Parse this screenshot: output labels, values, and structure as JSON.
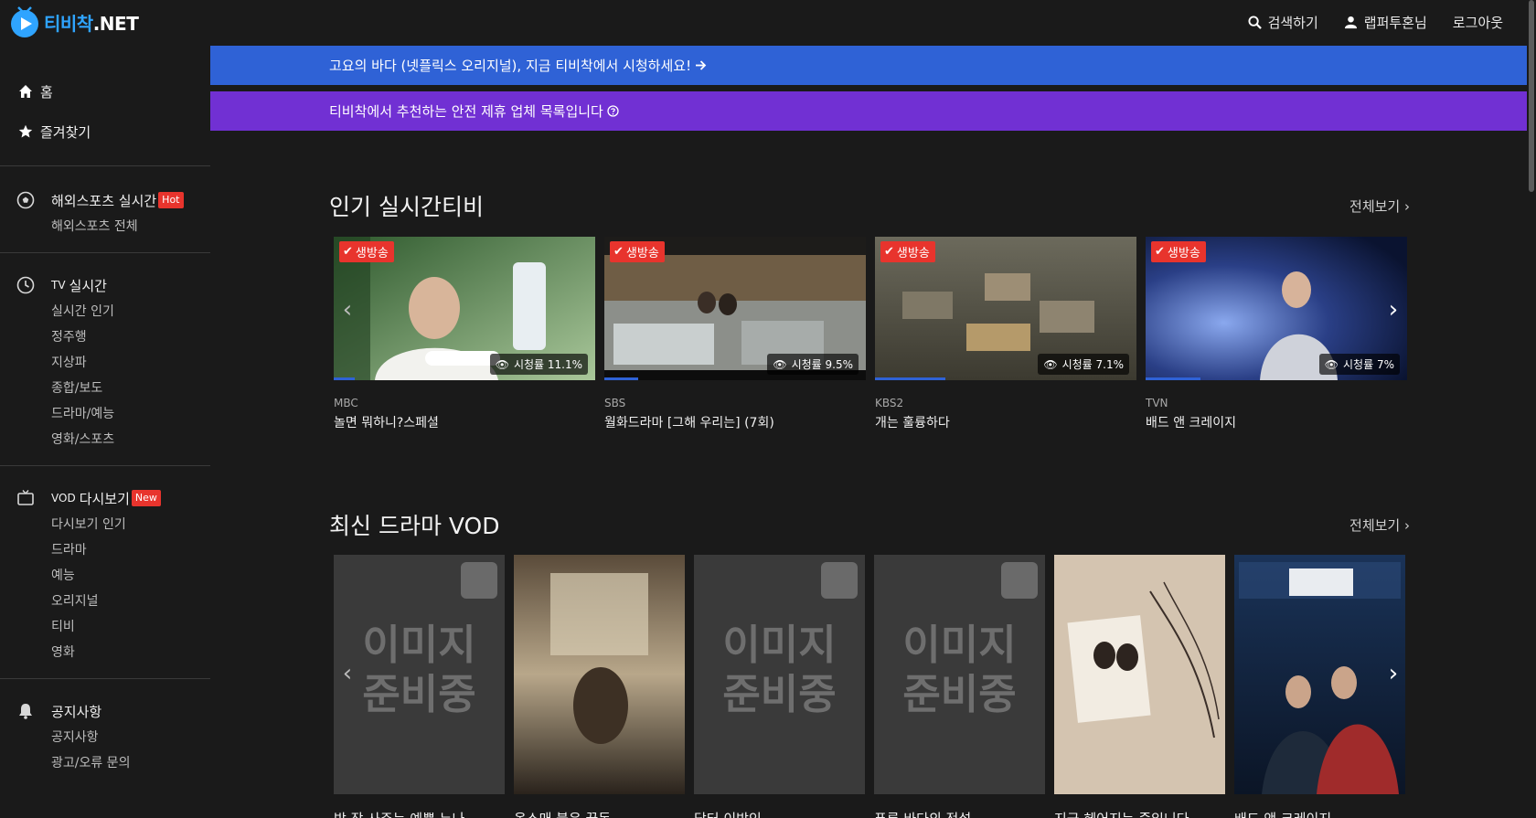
{
  "header": {
    "logo_text": "티비착",
    "logo_suffix": ".NET",
    "search_label": "검색하기",
    "user_label": "랩퍼투혼님",
    "logout_label": "로그아웃"
  },
  "sidebar": {
    "main_items": [
      {
        "label": "홈",
        "icon": "home-icon"
      },
      {
        "label": "즐겨찾기",
        "icon": "star-icon"
      }
    ],
    "sections": [
      {
        "title": "해외스포츠 실시간",
        "badge": "Hot",
        "icon": "soccer-ball-icon",
        "items": [
          "해외스포츠 전체"
        ]
      },
      {
        "title_tag": "TV",
        "title": "실시간",
        "icon": "clock-icon",
        "items": [
          "실시간 인기",
          "정주행",
          "지상파",
          "종합/보도",
          "드라마/예능",
          "영화/스포츠"
        ]
      },
      {
        "title_tag": "VOD",
        "title": "다시보기",
        "badge": "New",
        "icon": "tv-icon",
        "items": [
          "다시보기 인기",
          "드라마",
          "예능",
          "오리지널",
          "티비",
          "영화"
        ]
      },
      {
        "title": "공지사항",
        "icon": "bell-icon",
        "items": [
          "공지사항",
          "광고/오류 문의"
        ]
      }
    ]
  },
  "banners": {
    "blue": "고요의 바다 (넷플릭스 오리지널), 지금 티비착에서 시청하세요!",
    "purple": "티비착에서 추천하는 안전 제휴 업체 목록입니다"
  },
  "live_section": {
    "title": "인기 실시간티비",
    "see_all": "전체보기",
    "live_badge": "생방송",
    "cards": [
      {
        "channel": "MBC",
        "title": "놀면 뭐하니?스페셜",
        "rating": "시청률 11.1%",
        "progress": 0.08,
        "palette": [
          "#3d6b3a",
          "#9bbf8a"
        ]
      },
      {
        "channel": "SBS",
        "title": "월화드라마 [그해 우리는] (7회)",
        "rating": "시청률 9.5%",
        "progress": 0.13,
        "palette": [
          "#2e2c28",
          "#8a7e6a"
        ]
      },
      {
        "channel": "KBS2",
        "title": "개는 훌륭하다",
        "rating": "시청률 7.1%",
        "progress": 0.27,
        "palette": [
          "#4a4a3e",
          "#a49a82"
        ]
      },
      {
        "channel": "TVN",
        "title": "배드 앤 크레이지",
        "rating": "시청률 7%",
        "progress": 0.21,
        "palette": [
          "#12204a",
          "#6a8ad8"
        ]
      }
    ]
  },
  "vod_section": {
    "title": "최신 드라마 VOD",
    "see_all": "전체보기",
    "placeholder": "이미지 준비중",
    "items": [
      {
        "title": "밤 잠 사주는 예쁜 누나",
        "has_image": false
      },
      {
        "title": "옷소매 붉은 끝동",
        "has_image": true,
        "palette": [
          "#3a3228",
          "#b8a78a"
        ]
      },
      {
        "title": "닥터 이방인",
        "has_image": false
      },
      {
        "title": "푸른 바다의 전설",
        "has_image": false
      },
      {
        "title": "지금 헤어지는 중입니다",
        "has_image": true,
        "palette": [
          "#4a3a34",
          "#d9c9b8"
        ]
      },
      {
        "title": "배드 앤 크레이지",
        "has_image": true,
        "palette": [
          "#0e1f3a",
          "#3d6aa8"
        ]
      }
    ]
  }
}
